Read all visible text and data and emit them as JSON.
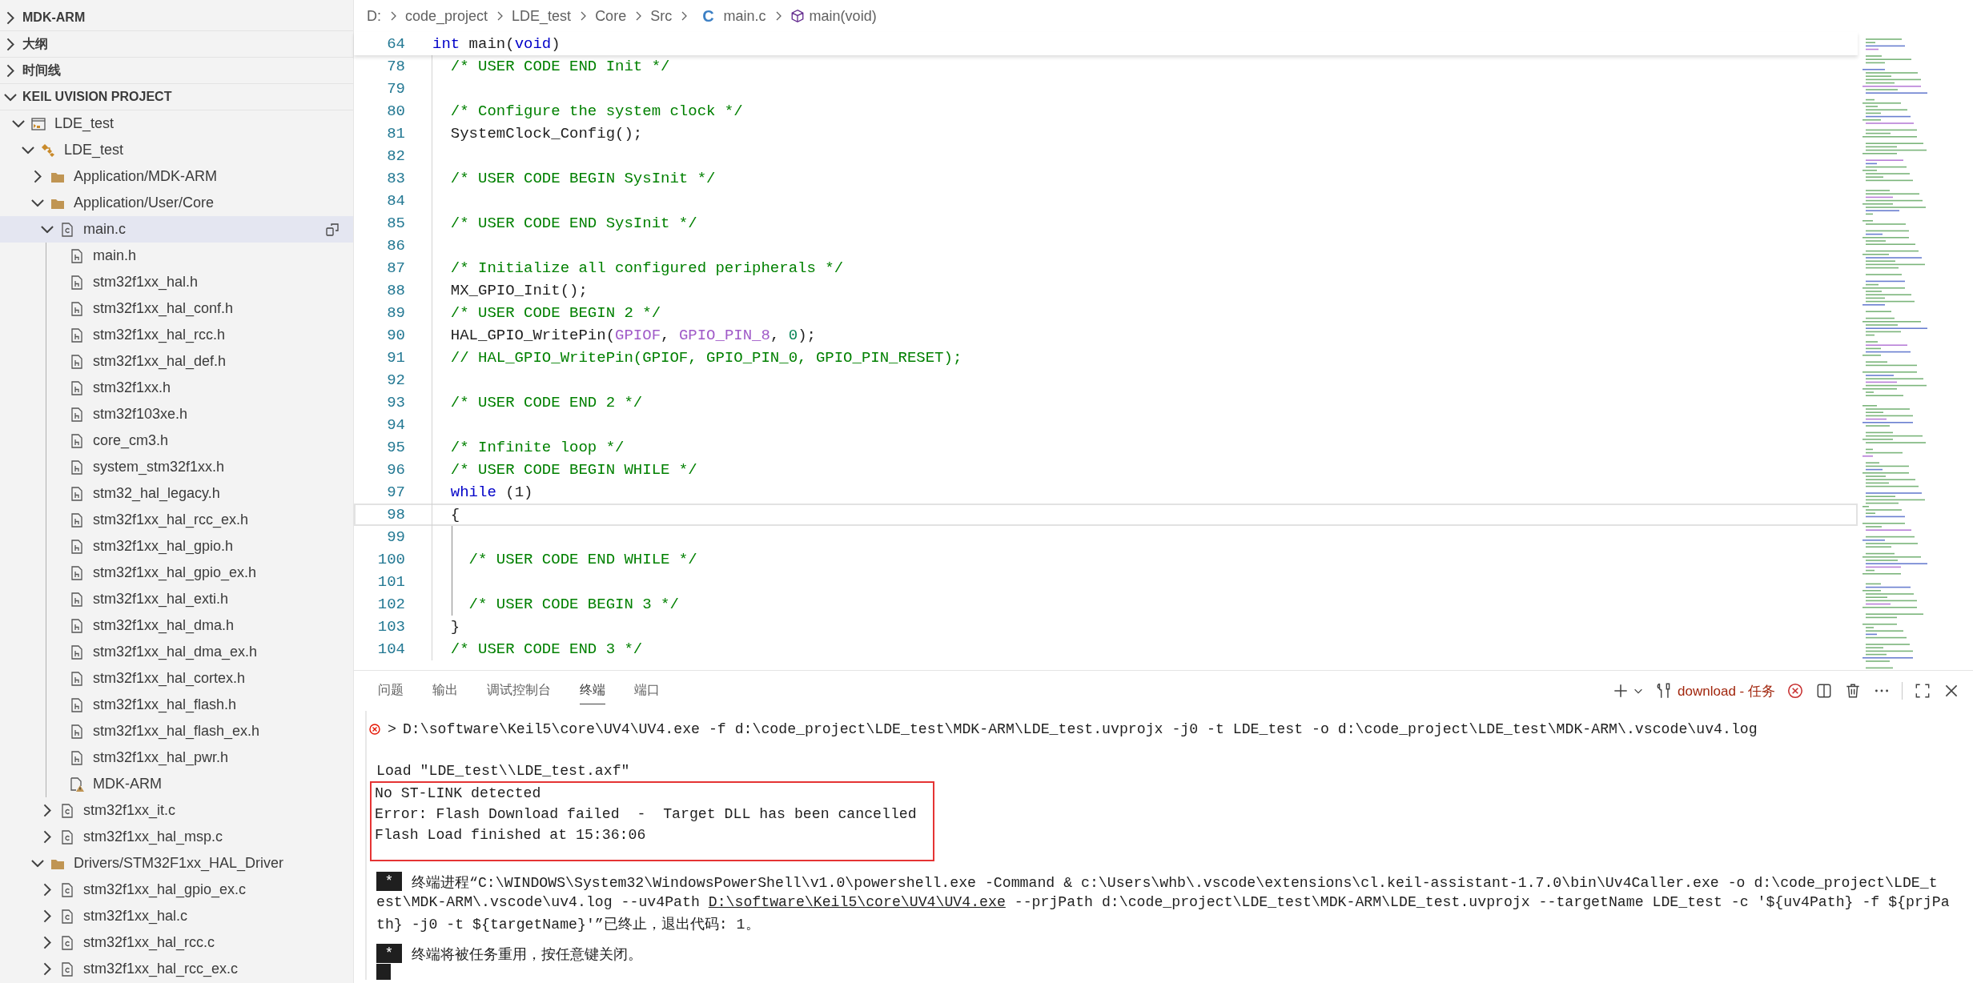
{
  "sidebar": {
    "sections": [
      {
        "title": "MDK-ARM",
        "expanded": false
      },
      {
        "title": "大纲",
        "expanded": false
      },
      {
        "title": "时间线",
        "expanded": false
      },
      {
        "title": "KEIL UVISION PROJECT",
        "expanded": true
      }
    ],
    "tree": [
      {
        "label": "LDE_test",
        "kind": "project",
        "expanded": true,
        "selected": false,
        "children": [
          {
            "label": "LDE_test",
            "kind": "target",
            "expanded": true,
            "selected": false,
            "children": [
              {
                "label": "Application/MDK-ARM",
                "kind": "folder",
                "expanded": false,
                "selected": false
              },
              {
                "label": "Application/User/Core",
                "kind": "folder",
                "expanded": true,
                "selected": false,
                "children": [
                  {
                    "label": "main.c",
                    "kind": "c",
                    "expanded": true,
                    "selected": true,
                    "children": [
                      {
                        "label": "main.h",
                        "kind": "h",
                        "selected": false
                      },
                      {
                        "label": "stm32f1xx_hal.h",
                        "kind": "h",
                        "selected": false
                      },
                      {
                        "label": "stm32f1xx_hal_conf.h",
                        "kind": "h",
                        "selected": false
                      },
                      {
                        "label": "stm32f1xx_hal_rcc.h",
                        "kind": "h",
                        "selected": false
                      },
                      {
                        "label": "stm32f1xx_hal_def.h",
                        "kind": "h",
                        "selected": false
                      },
                      {
                        "label": "stm32f1xx.h",
                        "kind": "h",
                        "selected": false
                      },
                      {
                        "label": "stm32f103xe.h",
                        "kind": "h",
                        "selected": false
                      },
                      {
                        "label": "core_cm3.h",
                        "kind": "h",
                        "selected": false
                      },
                      {
                        "label": "system_stm32f1xx.h",
                        "kind": "h",
                        "selected": false
                      },
                      {
                        "label": "stm32_hal_legacy.h",
                        "kind": "h",
                        "selected": false
                      },
                      {
                        "label": "stm32f1xx_hal_rcc_ex.h",
                        "kind": "h",
                        "selected": false
                      },
                      {
                        "label": "stm32f1xx_hal_gpio.h",
                        "kind": "h",
                        "selected": false
                      },
                      {
                        "label": "stm32f1xx_hal_gpio_ex.h",
                        "kind": "h",
                        "selected": false
                      },
                      {
                        "label": "stm32f1xx_hal_exti.h",
                        "kind": "h",
                        "selected": false
                      },
                      {
                        "label": "stm32f1xx_hal_dma.h",
                        "kind": "h",
                        "selected": false
                      },
                      {
                        "label": "stm32f1xx_hal_dma_ex.h",
                        "kind": "h",
                        "selected": false
                      },
                      {
                        "label": "stm32f1xx_hal_cortex.h",
                        "kind": "h",
                        "selected": false
                      },
                      {
                        "label": "stm32f1xx_hal_flash.h",
                        "kind": "h",
                        "selected": false
                      },
                      {
                        "label": "stm32f1xx_hal_flash_ex.h",
                        "kind": "h",
                        "selected": false
                      },
                      {
                        "label": "stm32f1xx_hal_pwr.h",
                        "kind": "h",
                        "selected": false
                      },
                      {
                        "label": "MDK-ARM",
                        "kind": "warn",
                        "selected": false
                      }
                    ]
                  },
                  {
                    "label": "stm32f1xx_it.c",
                    "kind": "c",
                    "expanded": false,
                    "selected": false
                  },
                  {
                    "label": "stm32f1xx_hal_msp.c",
                    "kind": "c",
                    "expanded": false,
                    "selected": false
                  }
                ]
              },
              {
                "label": "Drivers/STM32F1xx_HAL_Driver",
                "kind": "folder",
                "expanded": true,
                "selected": false,
                "children": [
                  {
                    "label": "stm32f1xx_hal_gpio_ex.c",
                    "kind": "c",
                    "expanded": false,
                    "selected": false
                  },
                  {
                    "label": "stm32f1xx_hal.c",
                    "kind": "c",
                    "expanded": false,
                    "selected": false
                  },
                  {
                    "label": "stm32f1xx_hal_rcc.c",
                    "kind": "c",
                    "expanded": false,
                    "selected": false
                  },
                  {
                    "label": "stm32f1xx_hal_rcc_ex.c",
                    "kind": "c",
                    "expanded": false,
                    "selected": false
                  }
                ]
              }
            ]
          }
        ]
      }
    ]
  },
  "editor": {
    "breadcrumb": [
      {
        "label": "D:",
        "kind": "folder"
      },
      {
        "label": "code_project",
        "kind": "folder"
      },
      {
        "label": "LDE_test",
        "kind": "folder"
      },
      {
        "label": "Core",
        "kind": "folder"
      },
      {
        "label": "Src",
        "kind": "folder"
      },
      {
        "label": "main.c",
        "kind": "file",
        "icon_text": "C"
      },
      {
        "label": "main(void)",
        "kind": "function"
      }
    ],
    "sticky_line": {
      "number": "64",
      "tokens": [
        {
          "text": "int",
          "kind": "keyword"
        },
        {
          "text": " main(",
          "kind": "plain"
        },
        {
          "text": "void",
          "kind": "keyword"
        },
        {
          "text": ")",
          "kind": "plain"
        }
      ]
    },
    "lines": [
      {
        "number": "78",
        "current": false,
        "guide": false,
        "tokens": [
          {
            "text": "  /* USER CODE END Init */",
            "kind": "comment"
          }
        ]
      },
      {
        "number": "79",
        "current": false,
        "guide": false
      },
      {
        "number": "80",
        "current": false,
        "guide": false,
        "tokens": [
          {
            "text": "  /* Configure the system clock */",
            "kind": "comment"
          }
        ]
      },
      {
        "number": "81",
        "current": false,
        "guide": false,
        "tokens": [
          {
            "text": "  SystemClock_Config();",
            "kind": "plain"
          }
        ]
      },
      {
        "number": "82",
        "current": false,
        "guide": false
      },
      {
        "number": "83",
        "current": false,
        "guide": false,
        "tokens": [
          {
            "text": "  /* USER CODE BEGIN SysInit */",
            "kind": "comment"
          }
        ]
      },
      {
        "number": "84",
        "current": false,
        "guide": false
      },
      {
        "number": "85",
        "current": false,
        "guide": false,
        "tokens": [
          {
            "text": "  /* USER CODE END SysInit */",
            "kind": "comment"
          }
        ]
      },
      {
        "number": "86",
        "current": false,
        "guide": false
      },
      {
        "number": "87",
        "current": false,
        "guide": false,
        "tokens": [
          {
            "text": "  /* Initialize all configured peripherals */",
            "kind": "comment"
          }
        ]
      },
      {
        "number": "88",
        "current": false,
        "guide": false,
        "tokens": [
          {
            "text": "  MX_GPIO_Init();",
            "kind": "plain"
          }
        ]
      },
      {
        "number": "89",
        "current": false,
        "guide": false,
        "tokens": [
          {
            "text": "  /* USER CODE BEGIN 2 */",
            "kind": "comment"
          }
        ]
      },
      {
        "number": "90",
        "current": false,
        "guide": false,
        "tokens": [
          {
            "text": "  HAL_GPIO_WritePin(",
            "kind": "plain"
          },
          {
            "text": "GPIOF",
            "kind": "macro"
          },
          {
            "text": ", ",
            "kind": "plain"
          },
          {
            "text": "GPIO_PIN_8",
            "kind": "macro"
          },
          {
            "text": ", ",
            "kind": "plain"
          },
          {
            "text": "0",
            "kind": "number"
          },
          {
            "text": ");",
            "kind": "plain"
          }
        ]
      },
      {
        "number": "91",
        "current": false,
        "guide": false,
        "tokens": [
          {
            "text": "  // HAL_GPIO_WritePin(GPIOF, GPIO_PIN_0, GPIO_PIN_RESET);",
            "kind": "comment"
          }
        ]
      },
      {
        "number": "92",
        "current": false,
        "guide": false
      },
      {
        "number": "93",
        "current": false,
        "guide": false,
        "tokens": [
          {
            "text": "  /* USER CODE END 2 */",
            "kind": "comment"
          }
        ]
      },
      {
        "number": "94",
        "current": false,
        "guide": false
      },
      {
        "number": "95",
        "current": false,
        "guide": false,
        "tokens": [
          {
            "text": "  /* Infinite loop */",
            "kind": "comment"
          }
        ]
      },
      {
        "number": "96",
        "current": false,
        "guide": false,
        "tokens": [
          {
            "text": "  /* USER CODE BEGIN WHILE */",
            "kind": "comment"
          }
        ]
      },
      {
        "number": "97",
        "current": false,
        "guide": false,
        "tokens": [
          {
            "text": "  while",
            "kind": "keyword"
          },
          {
            "text": " (1)",
            "kind": "plain"
          }
        ]
      },
      {
        "number": "98",
        "current": true,
        "guide": false,
        "tokens": [
          {
            "text": "  {",
            "kind": "plain"
          }
        ]
      },
      {
        "number": "99",
        "current": false,
        "guide": true
      },
      {
        "number": "100",
        "current": false,
        "guide": true,
        "tokens": [
          {
            "text": "    /* USER CODE END WHILE */",
            "kind": "comment"
          }
        ]
      },
      {
        "number": "101",
        "current": false,
        "guide": true
      },
      {
        "number": "102",
        "current": false,
        "guide": true,
        "tokens": [
          {
            "text": "    /* USER CODE BEGIN 3 */",
            "kind": "comment"
          }
        ]
      },
      {
        "number": "103",
        "current": false,
        "guide": false,
        "tokens": [
          {
            "text": "  }",
            "kind": "plain"
          }
        ]
      },
      {
        "number": "104",
        "current": false,
        "guide": false,
        "tokens": [
          {
            "text": "  /* USER CODE END 3 */",
            "kind": "comment"
          }
        ]
      }
    ]
  },
  "panel": {
    "tabs": [
      {
        "label": "问题",
        "selected": false
      },
      {
        "label": "输出",
        "selected": false
      },
      {
        "label": "调试控制台",
        "selected": false
      },
      {
        "label": "终端",
        "selected": true
      },
      {
        "label": "端口",
        "selected": false
      }
    ],
    "task_label": "download - 任务",
    "terminal": [
      {
        "kind": "command",
        "error": true,
        "prompt": ">",
        "text": "D:\\software\\Keil5\\core\\UV4\\UV4.exe -f d:\\code_project\\LDE_test\\MDK-ARM\\LDE_test.uvprojx -j0 -t LDE_test -o d:\\code_project\\LDE_test\\MDK-ARM\\.vscode\\uv4.log"
      },
      {
        "kind": "output",
        "lines": [
          "Load \"LDE_test\\\\LDE_test.axf\""
        ]
      },
      {
        "kind": "boxed",
        "lines": [
          "No ST-LINK detected",
          "Error: Flash Download failed  -  Target DLL has been cancelled",
          "Flash Load finished at 15:36:06"
        ]
      },
      {
        "kind": "task",
        "badge": "*",
        "lines": [
          {
            "text": "终端进程“C:\\WINDOWS\\System32\\WindowsPowerShell\\v1.0\\powershell.exe -Command & c:\\Users\\whb\\.vscode\\extensions\\cl.keil-assistant-1.7.0\\bin\\Uv4Caller.exe -o d:\\code_project\\LDE_t"
          },
          {
            "text": "est\\MDK-ARM\\.vscode\\uv4.log --uv4Path ",
            "link": "D:\\software\\Keil5\\core\\UV4\\UV4.exe",
            "rest": " --prjPath d:\\code_project\\LDE_test\\MDK-ARM\\LDE_test.uvprojx --targetName LDE_test -c '${uv4Path} -f ${prjPa"
          },
          {
            "text": "th} -j0 -t ${targetName}'”已终止，退出代码: 1。"
          }
        ]
      },
      {
        "kind": "task",
        "badge": "*",
        "cursor": true,
        "lines": [
          {
            "text": "终端将被任务重用，按任意键关闭。"
          }
        ]
      }
    ]
  }
}
